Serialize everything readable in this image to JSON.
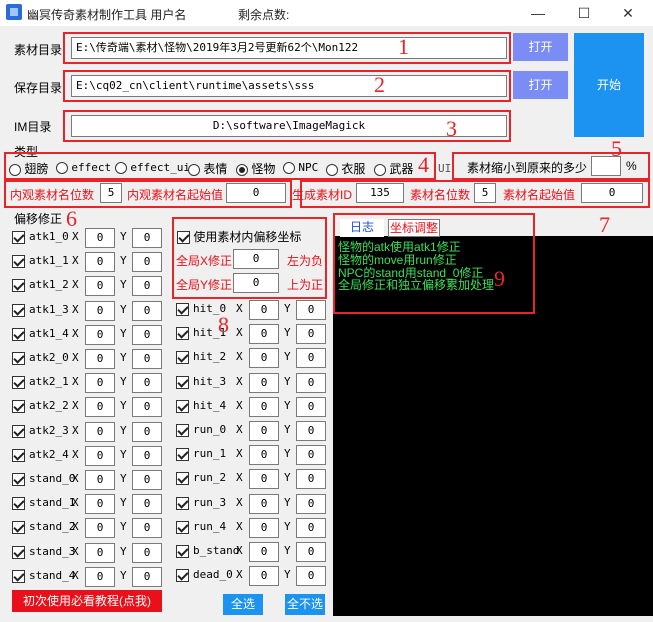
{
  "window": {
    "title": "幽冥传奇素材制作工具 用户名:",
    "title_tail": "剩余点数:",
    "minimize": "—",
    "maximize": "☐",
    "close": "✕"
  },
  "paths": {
    "source_label": "素材目录",
    "source_value": "E:\\传奇端\\素材\\怪物\\2019年3月2号更新62个\\Mon122",
    "save_label": "保存目录",
    "save_value": "E:\\cq02_cn\\client\\runtime\\assets\\sss",
    "im_label": "IM目录",
    "im_value": "D:\\software\\ImageMagick",
    "open1": "打开",
    "open2": "打开",
    "start": "开始"
  },
  "annotations": [
    "1",
    "2",
    "3",
    "4",
    "5",
    "6",
    "7",
    "8",
    "9"
  ],
  "type_group": {
    "label": "类型",
    "options": [
      "翅膀",
      "effect",
      "effect_ui",
      "表情",
      "怪物",
      "NPC",
      "衣服",
      "武器"
    ],
    "selected": "怪物",
    "trailing": "UI"
  },
  "scale": {
    "label": "素材缩小到原来的多少",
    "value": "",
    "unit": "%"
  },
  "inner_name": {
    "digits_label": "内观素材名位数",
    "digits_value": "5",
    "start_label": "内观素材名起始值",
    "start_value": "0"
  },
  "gen": {
    "id_label": "生成素材ID",
    "id_value": "135",
    "digits_label": "素材名位数",
    "digits_value": "5",
    "start_label": "素材名起始值",
    "start_value": "0"
  },
  "offset": {
    "group_label": "偏移修正",
    "x_label": "X",
    "y_label": "Y",
    "left_rows": [
      {
        "name": "atk1_0",
        "checked": true,
        "x": "0",
        "y": "0"
      },
      {
        "name": "atk1_1",
        "checked": true,
        "x": "0",
        "y": "0"
      },
      {
        "name": "atk1_2",
        "checked": true,
        "x": "0",
        "y": "0"
      },
      {
        "name": "atk1_3",
        "checked": true,
        "x": "0",
        "y": "0"
      },
      {
        "name": "atk1_4",
        "checked": true,
        "x": "0",
        "y": "0"
      },
      {
        "name": "atk2_0",
        "checked": true,
        "x": "0",
        "y": "0"
      },
      {
        "name": "atk2_1",
        "checked": true,
        "x": "0",
        "y": "0"
      },
      {
        "name": "atk2_2",
        "checked": true,
        "x": "0",
        "y": "0"
      },
      {
        "name": "atk2_3",
        "checked": true,
        "x": "0",
        "y": "0"
      },
      {
        "name": "atk2_4",
        "checked": true,
        "x": "0",
        "y": "0"
      },
      {
        "name": "stand_0",
        "checked": true,
        "x": "0",
        "y": "0"
      },
      {
        "name": "stand_1",
        "checked": true,
        "x": "0",
        "y": "0"
      },
      {
        "name": "stand_2",
        "checked": true,
        "x": "0",
        "y": "0"
      },
      {
        "name": "stand_3",
        "checked": true,
        "x": "0",
        "y": "0"
      },
      {
        "name": "stand_4",
        "checked": true,
        "x": "0",
        "y": "0"
      }
    ],
    "right_rows": [
      {
        "name": "hit_0",
        "checked": true,
        "x": "0",
        "y": "0"
      },
      {
        "name": "hit_1",
        "checked": true,
        "x": "0",
        "y": "0"
      },
      {
        "name": "hit_2",
        "checked": true,
        "x": "0",
        "y": "0"
      },
      {
        "name": "hit_3",
        "checked": true,
        "x": "0",
        "y": "0"
      },
      {
        "name": "hit_4",
        "checked": true,
        "x": "0",
        "y": "0"
      },
      {
        "name": "run_0",
        "checked": true,
        "x": "0",
        "y": "0"
      },
      {
        "name": "run_1",
        "checked": true,
        "x": "0",
        "y": "0"
      },
      {
        "name": "run_2",
        "checked": true,
        "x": "0",
        "y": "0"
      },
      {
        "name": "run_3",
        "checked": true,
        "x": "0",
        "y": "0"
      },
      {
        "name": "run_4",
        "checked": true,
        "x": "0",
        "y": "0"
      },
      {
        "name": "b_stand",
        "checked": true,
        "x": "0",
        "y": "0"
      },
      {
        "name": "dead_0",
        "checked": true,
        "x": "0",
        "y": "0"
      }
    ]
  },
  "inner_offset": {
    "checkbox_label": "使用素材内偏移坐标",
    "checked": true,
    "gx_label": "全局X修正",
    "gx_value": "0",
    "gx_hint": "左为负",
    "gy_label": "全局Y修正",
    "gy_value": "0",
    "gy_hint": "上为正"
  },
  "log": {
    "tab_log": "日志",
    "tab_coord": "坐标调整",
    "lines": [
      "怪物的atk使用atk1修正",
      "怪物的move用run修正",
      "NPC的stand用stand_0修正",
      "全局修正和独立偏移累加处理"
    ]
  },
  "bottom": {
    "tutorial": "初次使用必看教程(点我)",
    "select_all": "全选",
    "select_none": "全不选"
  },
  "colors": {
    "annotation_red": "#e8232a",
    "button_blue": "#7b8df5",
    "start_blue": "#1c93f0",
    "log_green": "#3ce05a"
  }
}
